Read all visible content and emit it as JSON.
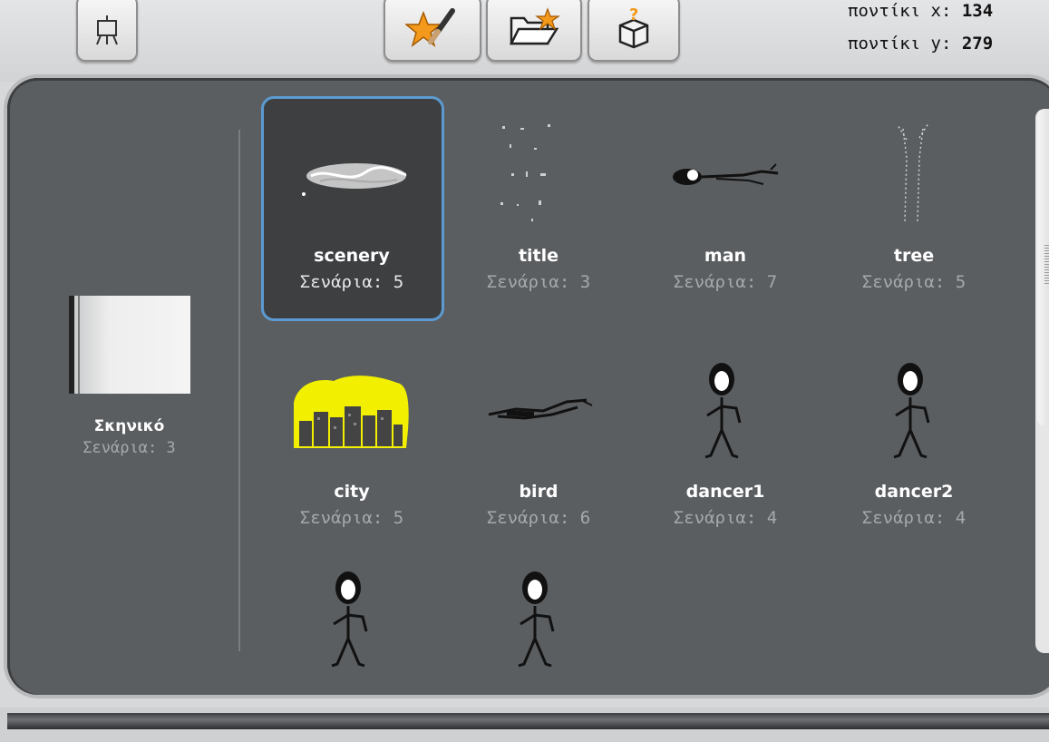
{
  "toolbar": {
    "stage_icon": "stage-easel-icon",
    "buttons": [
      {
        "id": "paint-new-sprite",
        "icon": "paintbrush-star-icon"
      },
      {
        "id": "choose-sprite-from-file",
        "icon": "folder-star-icon"
      },
      {
        "id": "surprise-sprite",
        "icon": "question-box-icon"
      }
    ]
  },
  "mouse": {
    "x_label": "ποντίκι x:",
    "x_value": "134",
    "y_label": "ποντίκι y:",
    "y_value": "279"
  },
  "stage": {
    "name": "Σκηνικό",
    "scripts": "Σενάρια: 3"
  },
  "sprites": [
    {
      "name": "scenery",
      "scripts": "Σενάρια: 5",
      "selected": true,
      "thumb": "scenery"
    },
    {
      "name": "title",
      "scripts": "Σενάρια: 3",
      "thumb": "title"
    },
    {
      "name": "man",
      "scripts": "Σενάρια: 7",
      "thumb": "man"
    },
    {
      "name": "tree",
      "scripts": "Σενάρια: 5",
      "thumb": "tree"
    },
    {
      "name": "city",
      "scripts": "Σενάρια: 5",
      "thumb": "city"
    },
    {
      "name": "bird",
      "scripts": "Σενάρια: 6",
      "thumb": "bird"
    },
    {
      "name": "dancer1",
      "scripts": "Σενάρια: 4",
      "thumb": "dancer"
    },
    {
      "name": "dancer2",
      "scripts": "Σενάρια: 4",
      "thumb": "dancer"
    },
    {
      "name": "",
      "scripts": "",
      "thumb": "dancer"
    },
    {
      "name": "",
      "scripts": "",
      "thumb": "dancer"
    }
  ],
  "colors": {
    "panel": "#5b5e61",
    "selected_border": "#5c9bd1",
    "city_yellow": "#f2f000"
  }
}
